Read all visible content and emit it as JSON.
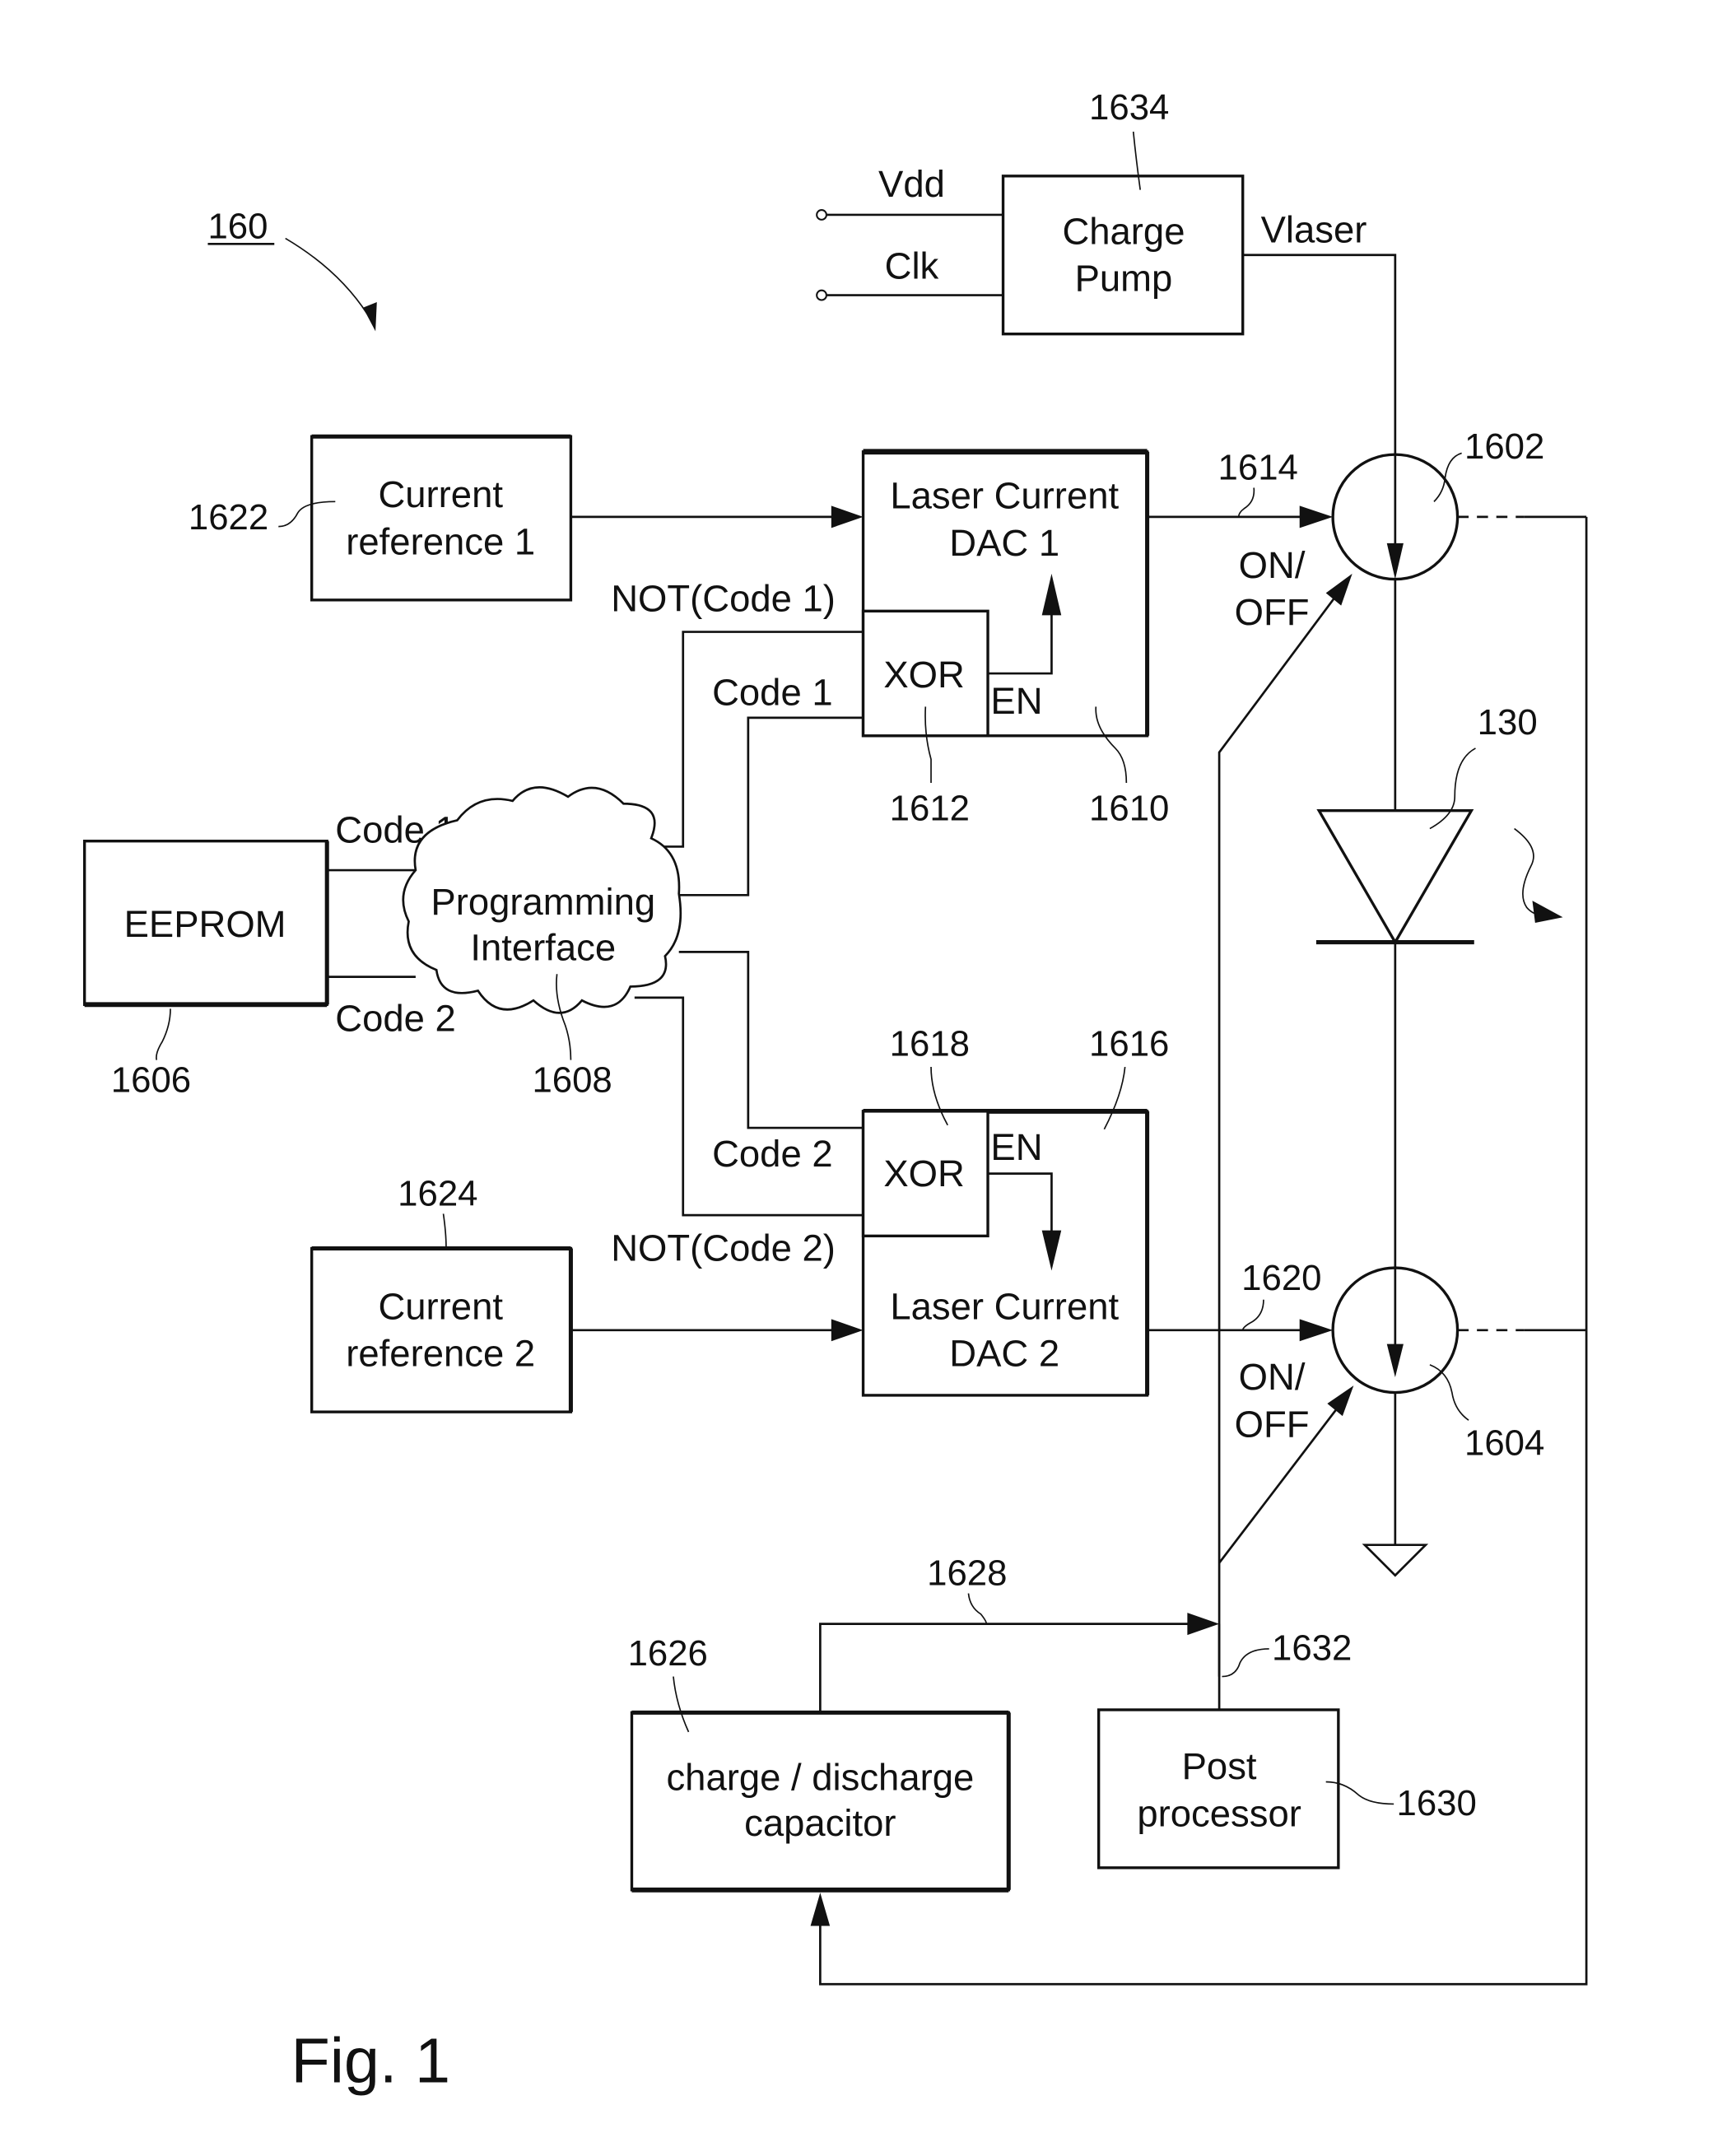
{
  "figure": {
    "caption": "Fig. 1",
    "reference": "160"
  },
  "blocks": {
    "charge_pump": {
      "line1": "Charge",
      "line2": "Pump",
      "ref": "1634"
    },
    "current_ref_1": {
      "line1": "Current",
      "line2": "reference 1",
      "ref": "1622"
    },
    "current_ref_2": {
      "line1": "Current",
      "line2": "reference 2",
      "ref": "1624"
    },
    "dac1": {
      "line1": "Laser Current",
      "line2": "DAC 1",
      "ref": "1610"
    },
    "dac2": {
      "line1": "Laser Current",
      "line2": "DAC 2",
      "ref": "1616"
    },
    "xor1": {
      "label": "XOR",
      "ref": "1612",
      "en": "EN"
    },
    "xor2": {
      "label": "XOR",
      "ref": "1618",
      "en": "EN"
    },
    "eeprom": {
      "label": "EEPROM",
      "ref": "1606"
    },
    "prog_interface": {
      "line1": "Programming",
      "line2": "Interface",
      "ref": "1608"
    },
    "capacitor": {
      "line1": "charge / discharge",
      "line2": "capacitor",
      "ref": "1626"
    },
    "post_processor": {
      "line1": "Post",
      "line2": "processor",
      "ref": "1630"
    },
    "switch1": {
      "ref": "1602"
    },
    "switch2": {
      "ref": "1604"
    },
    "laser_diode": {
      "ref": "130"
    }
  },
  "signals": {
    "vdd": "Vdd",
    "clk": "Clk",
    "vlaser": "Vlaser",
    "not_code1": "NOT(Code 1)",
    "code1_dac": "Code 1",
    "code1_eeprom": "Code 1",
    "code2_eeprom": "Code 2",
    "code2_dac": "Code 2",
    "not_code2": "NOT(Code 2)",
    "onoff1_l1": "ON/",
    "onoff1_l2": "OFF",
    "onoff2_l1": "ON/",
    "onoff2_l2": "OFF",
    "line_1614": "1614",
    "line_1620": "1620",
    "line_1628": "1628",
    "line_1632": "1632"
  }
}
